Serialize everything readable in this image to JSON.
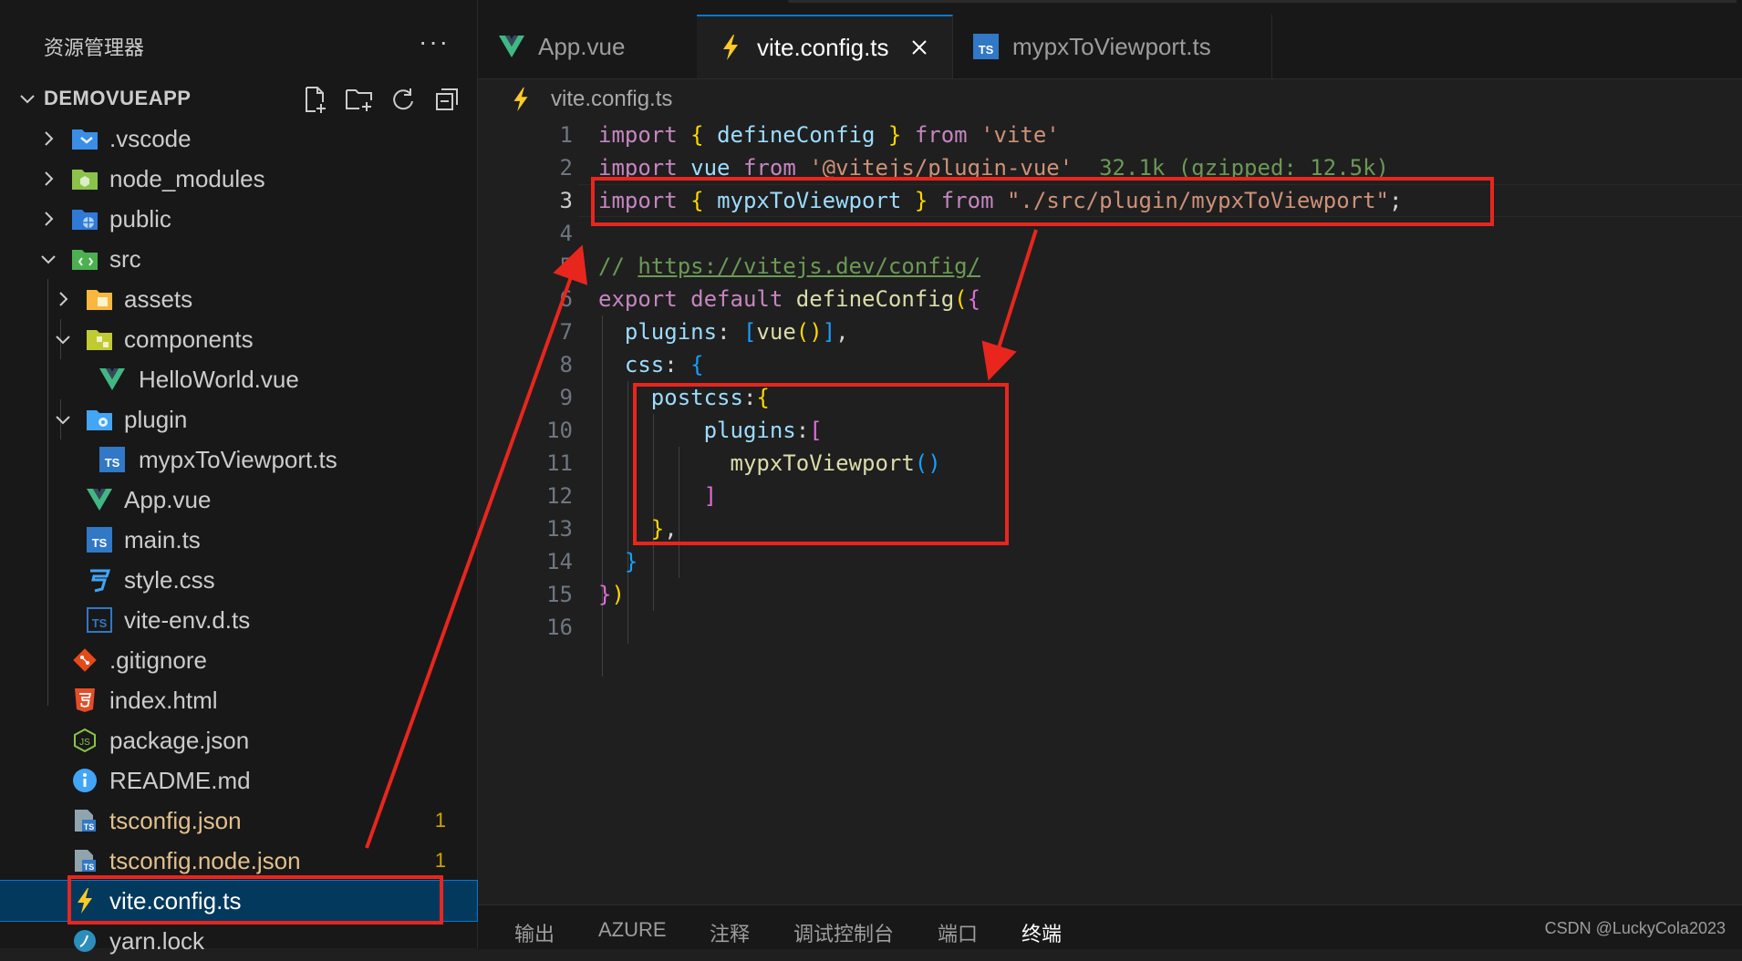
{
  "explorer": {
    "title": "资源管理器",
    "more": "···",
    "project": "DEMOVUEAPP"
  },
  "tree": [
    {
      "label": ".vscode",
      "icon": "vscode-folder-icon",
      "expanded": false
    },
    {
      "label": "node_modules",
      "icon": "node-folder-icon",
      "expanded": false
    },
    {
      "label": "public",
      "icon": "public-folder-icon",
      "expanded": false
    },
    {
      "label": "src",
      "icon": "src-folder-icon",
      "expanded": true
    },
    {
      "label": "assets",
      "icon": "assets-folder-icon",
      "expanded": false
    },
    {
      "label": "components",
      "icon": "components-folder-icon",
      "expanded": true
    },
    {
      "label": "HelloWorld.vue",
      "icon": "vue-icon"
    },
    {
      "label": "plugin",
      "icon": "plugin-folder-icon",
      "expanded": true
    },
    {
      "label": "mypxToViewport.ts",
      "icon": "typescript-icon"
    },
    {
      "label": "App.vue",
      "icon": "vue-icon"
    },
    {
      "label": "main.ts",
      "icon": "typescript-icon"
    },
    {
      "label": "style.css",
      "icon": "css-icon"
    },
    {
      "label": "vite-env.d.ts",
      "icon": "typescript-def-icon"
    },
    {
      "label": ".gitignore",
      "icon": "git-icon"
    },
    {
      "label": "index.html",
      "icon": "html-icon"
    },
    {
      "label": "package.json",
      "icon": "nodejs-icon"
    },
    {
      "label": "README.md",
      "icon": "info-icon"
    },
    {
      "label": "tsconfig.json",
      "icon": "tsconfig-icon",
      "badge": "1"
    },
    {
      "label": "tsconfig.node.json",
      "icon": "tsconfig-icon",
      "badge": "1"
    },
    {
      "label": "vite.config.ts",
      "icon": "vite-icon",
      "selected": true
    },
    {
      "label": "yarn.lock",
      "icon": "yarn-icon"
    }
  ],
  "tabs": [
    {
      "label": "App.vue",
      "icon": "vue-icon"
    },
    {
      "label": "vite.config.ts",
      "icon": "vite-icon",
      "active": true,
      "close": "✕"
    },
    {
      "label": "mypxToViewport.ts",
      "icon": "typescript-icon"
    }
  ],
  "breadcrumb": "vite.config.ts",
  "code": {
    "line_numbers": [
      "1",
      "2",
      "3",
      "4",
      "5",
      "6",
      "7",
      "8",
      "9",
      "10",
      "11",
      "12",
      "13",
      "14",
      "15",
      "16"
    ],
    "current_line": 3,
    "l1": {
      "import": "import",
      "b1": "{",
      "name": "defineConfig",
      "b2": "}",
      "from": "from",
      "str": "'vite'"
    },
    "l2": {
      "import": "import",
      "name": "vue",
      "from": "from",
      "str": "'@vitejs/plugin-vue'",
      "hint": "32.1k (gzipped: 12.5k)"
    },
    "l3": {
      "import": "import",
      "b1": "{",
      "name": "mypxToViewport",
      "b2": "}",
      "from": "from",
      "str": "\"./src/plugin/mypxToViewport\"",
      "semi": ";"
    },
    "l5": {
      "comment": "//",
      "url": "https://vitejs.dev/config/"
    },
    "l6": {
      "export": "export",
      "default": "default",
      "fn": "defineConfig",
      "p": "(",
      "b": "{"
    },
    "l7": {
      "key": "plugins",
      "colon": ":",
      "b": "[",
      "fn": "vue",
      "p": "()",
      "bc": "]",
      "comma": ","
    },
    "l8": {
      "key": "css",
      "colon": ":",
      "b": "{"
    },
    "l9": {
      "key": "postcss",
      "colon": ":",
      "b": "{"
    },
    "l10": {
      "key": "plugins",
      "colon": ":",
      "b": "["
    },
    "l11": {
      "fn": "mypxToViewport",
      "p": "()"
    },
    "l12": {
      "b": "]"
    },
    "l13": {
      "b": "}",
      "comma": ","
    },
    "l14": {
      "b": "}"
    },
    "l15": {
      "b": "}",
      "p": ")"
    }
  },
  "panel": {
    "tabs": [
      "输出",
      "AZURE",
      "注释",
      "调试控制台",
      "端口",
      "终端"
    ],
    "active": "终端"
  },
  "watermark": "CSDN @LuckyCola2023",
  "colors": {
    "accent": "#0078d4",
    "annotation": "#e8261e",
    "selection": "#04395e",
    "modified": "#e2c08d"
  }
}
